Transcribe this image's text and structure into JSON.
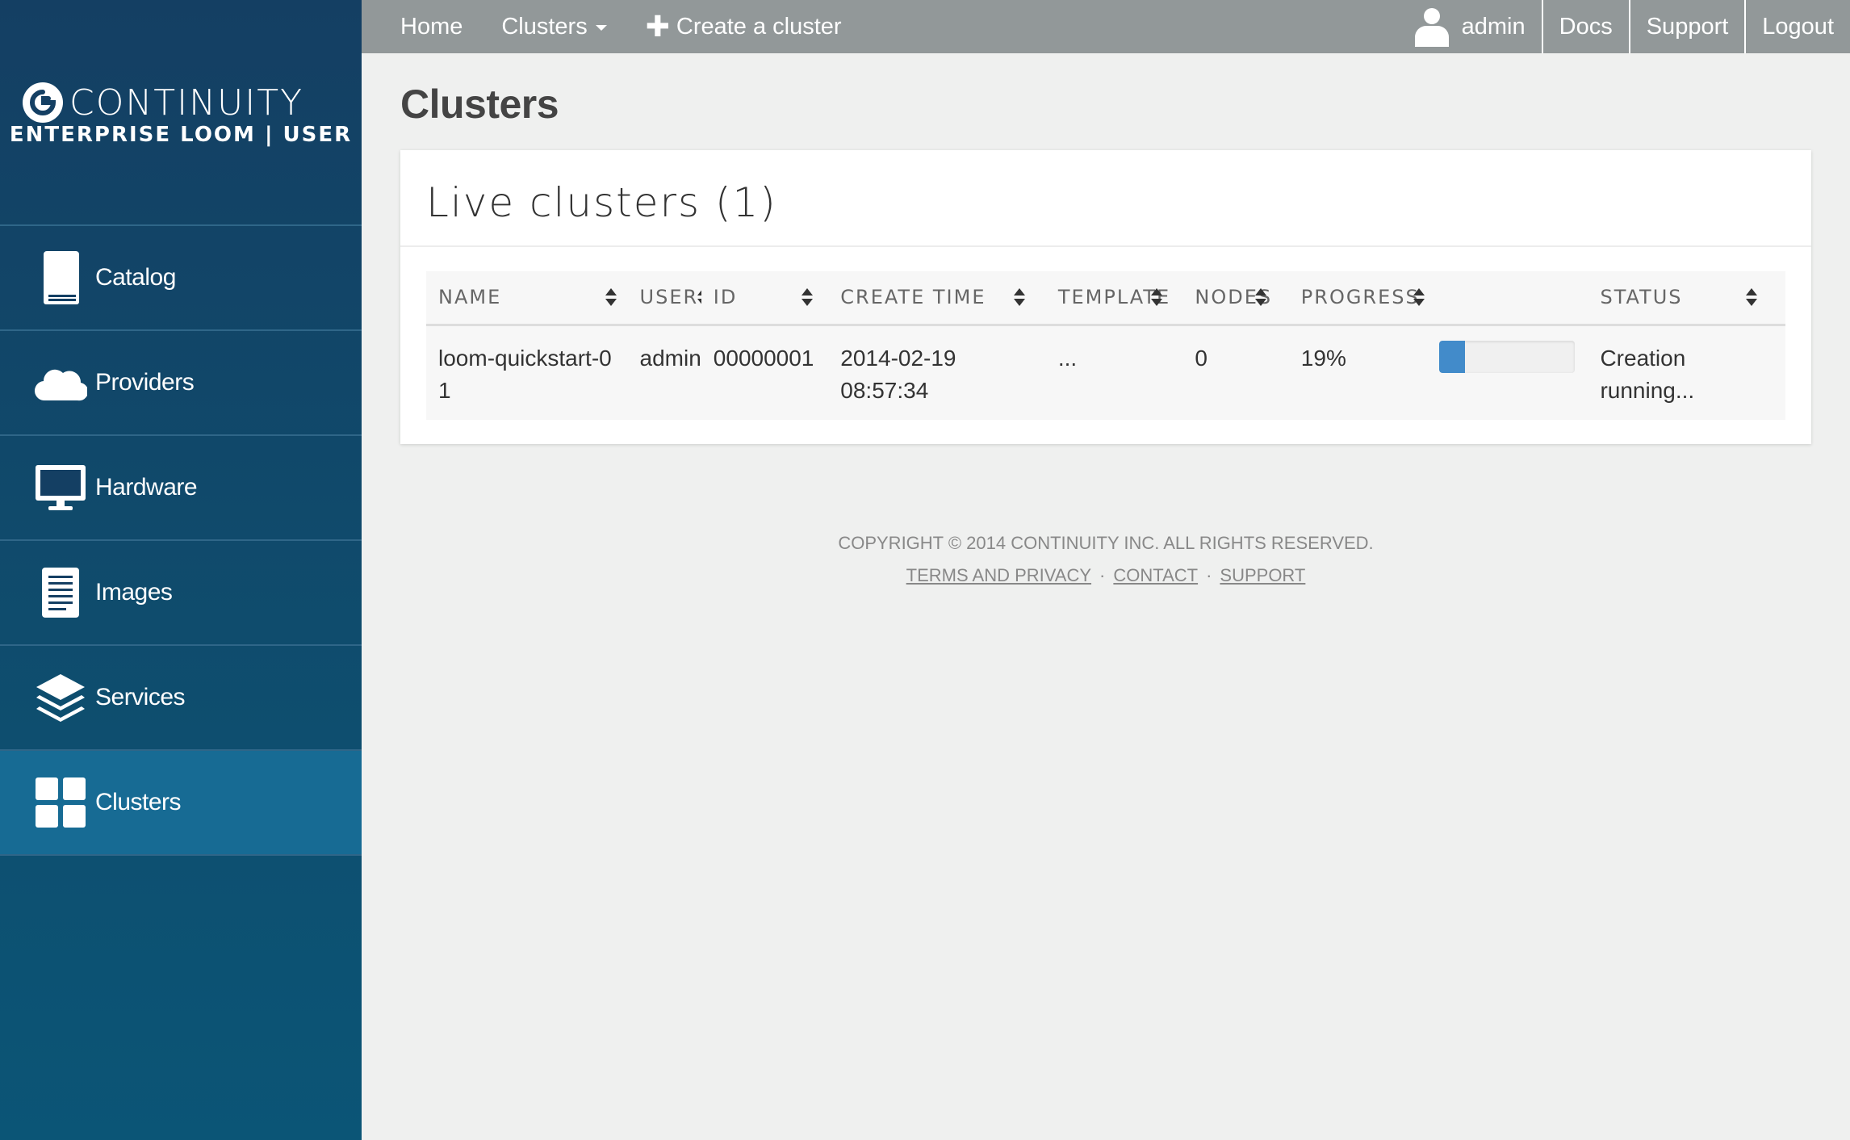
{
  "brand": {
    "name": "CONTINUITY",
    "subtitle": "ENTERPRISE LOOM | USER"
  },
  "sidebar": {
    "items": [
      {
        "label": "Catalog",
        "icon": "book-icon"
      },
      {
        "label": "Providers",
        "icon": "cloud-icon"
      },
      {
        "label": "Hardware",
        "icon": "monitor-icon"
      },
      {
        "label": "Images",
        "icon": "document-icon"
      },
      {
        "label": "Services",
        "icon": "layers-icon"
      },
      {
        "label": "Clusters",
        "icon": "grid-icon",
        "active": true
      }
    ]
  },
  "topbar": {
    "home": "Home",
    "clusters": "Clusters",
    "create": "Create a cluster",
    "user": "admin",
    "docs": "Docs",
    "support": "Support",
    "logout": "Logout"
  },
  "page": {
    "title": "Clusters"
  },
  "panel": {
    "title": "Live clusters (1)",
    "columns": [
      "NAME",
      "USER",
      "ID",
      "CREATE TIME",
      "TEMPLATE",
      "NODES",
      "PROGRESS",
      "STATUS"
    ],
    "rows": [
      {
        "name": "loom-quickstart-01",
        "user": "admin",
        "id": "00000001",
        "create_time": "2014-02-19 08:57:34",
        "template": "...",
        "nodes": "0",
        "progress_label": "19%",
        "progress": 0.19,
        "status": "Creation running..."
      }
    ]
  },
  "footer": {
    "copyright": "COPYRIGHT © 2014 CONTINUITY INC. ALL RIGHTS RESERVED.",
    "terms": "TERMS AND PRIVACY",
    "contact": "CONTACT",
    "support": "SUPPORT",
    "separator": "·"
  },
  "colors": {
    "sidebar": "#143f63",
    "sidebar_active": "#176b94",
    "topbar": "#929899",
    "progress": "#428bca"
  }
}
